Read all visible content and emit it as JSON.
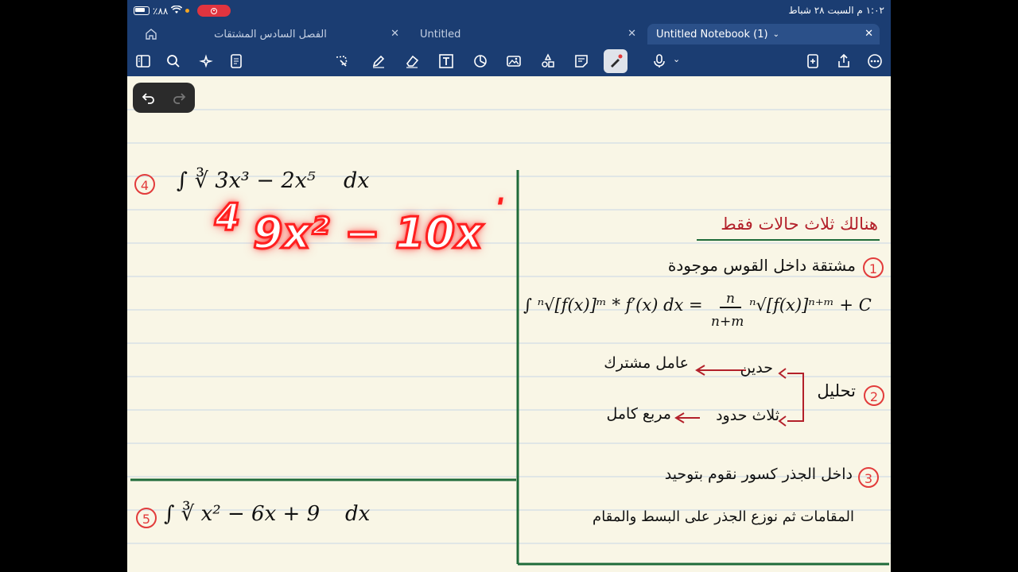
{
  "status_bar": {
    "battery": "٪۸۸",
    "time_date": "١:٠٢ م  السبت ٢٨ شباط"
  },
  "tabs": [
    {
      "label": "الفصل السادس المشتقات"
    },
    {
      "label": "Untitled"
    },
    {
      "label": "Untitled Notebook (1)",
      "chevron": "chevron-down-icon"
    }
  ],
  "toolbar": {
    "left_icons": [
      "sidebar-icon",
      "search-icon",
      "sparkle-icon",
      "document-icon"
    ],
    "center_icons": [
      "lasso-icon",
      "pen-icon",
      "eraser-icon",
      "text-box-icon",
      "shapes-icon",
      "image-icon",
      "elements-icon",
      "sticky-note-icon",
      "laser-pointer-icon",
      "mic-icon"
    ],
    "right_icons": [
      "add-page-icon",
      "share-icon",
      "more-icon"
    ]
  },
  "notes": {
    "problem4": {
      "number": "4",
      "expr_main": "∫ ∛ 3x³ − 2x⁵",
      "dx": "dx"
    },
    "derivative": {
      "arrow": "4",
      "expr": "9x² − 10x",
      "extra": "ˈ"
    },
    "problem5": {
      "number": "5",
      "expr_main": "∫ ∛ x² − 6x + 9",
      "dx": "dx"
    },
    "right": {
      "heading": "هنالك ثلاث حالات فقط",
      "case1_num": "1",
      "case1_text": "مشتقة داخل القوس موجودة",
      "formula_left": "∫ ⁿ√[f(x)]ᵐ * f′(x) dx =",
      "formula_frac_num": "n",
      "formula_frac_den": "n+m",
      "formula_right": "ⁿ√[f(x)]ⁿ⁺ᵐ + C",
      "case2_num": "2",
      "case2_label": "تحليل",
      "case2_a_from": "حدين",
      "case2_a_to": "عامل مشترك",
      "case2_b_from": "ثلاث حدود",
      "case2_b_to": "مربع كامل",
      "case3_num": "3",
      "case3_line1": "داخل الجذر كسور نقوم بتوحيد",
      "case3_line2": "المقامات ثم نوزع الجذر على البسط والمقام"
    }
  },
  "colors": {
    "header": "#1b3d72",
    "paper": "#f9f6e6",
    "rule": "#c7d6e6",
    "divider": "#1f6b3a",
    "accent_red": "#e23b3b"
  }
}
